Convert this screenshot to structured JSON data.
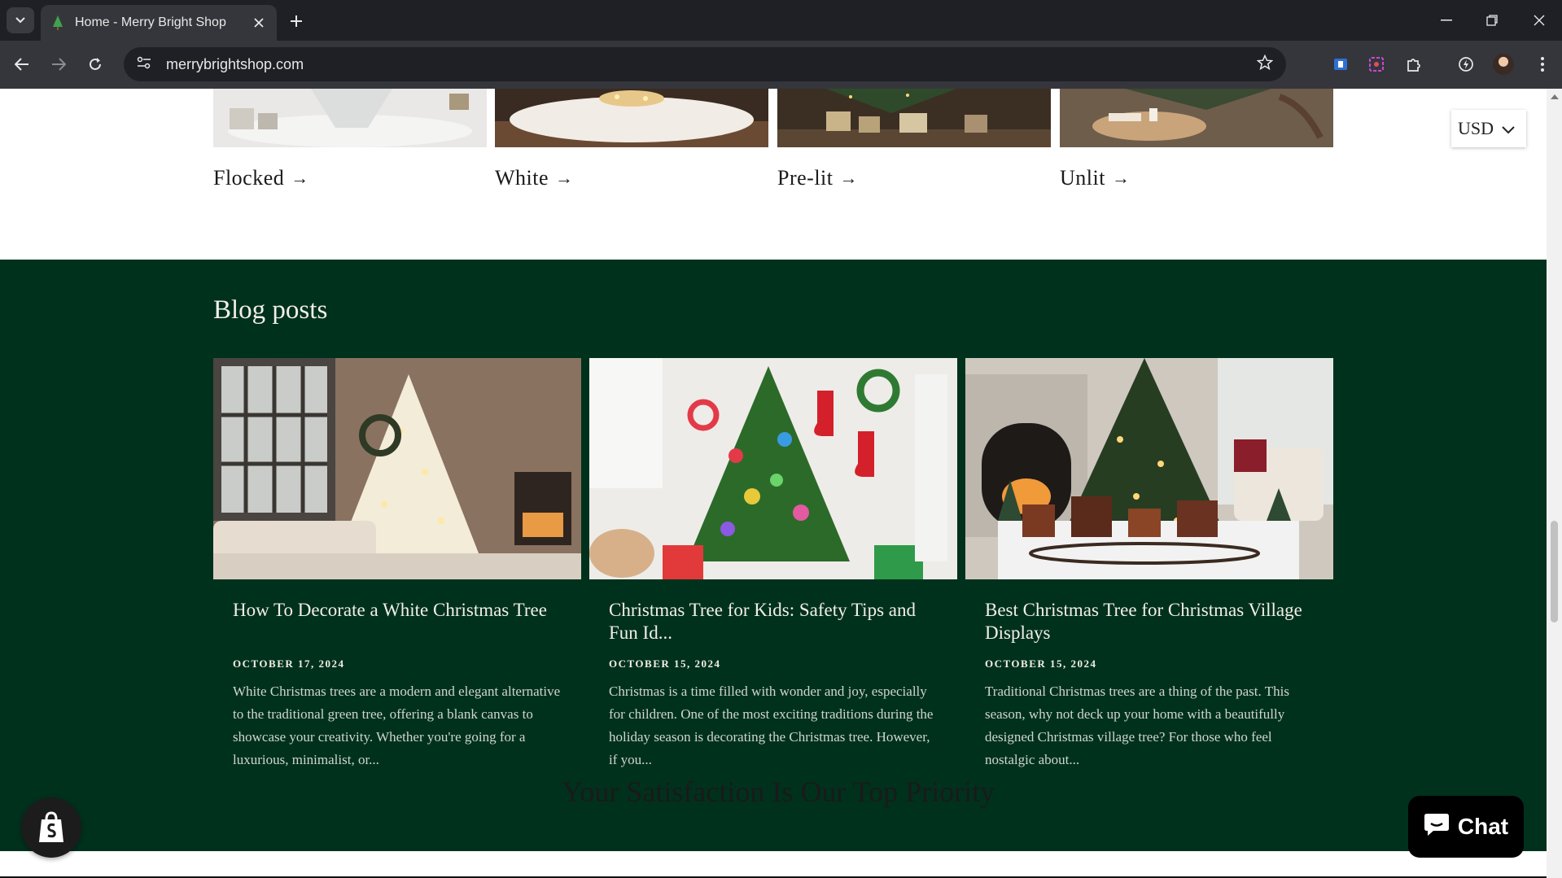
{
  "browser": {
    "tab_title": "Home - Merry Bright Shop",
    "url": "merrybrightshop.com",
    "icons": [
      "tab-search-icon",
      "tree-favicon-icon",
      "close-icon",
      "plus-icon",
      "minimize-icon",
      "restore-icon",
      "window-close-icon",
      "back-icon",
      "forward-icon",
      "reload-icon",
      "site-settings-icon",
      "star-icon",
      "extension-icon",
      "puzzle-icon",
      "avatar",
      "menu-icon"
    ]
  },
  "categories": [
    {
      "label": "Flocked"
    },
    {
      "label": "White"
    },
    {
      "label": "Pre-lit"
    },
    {
      "label": "Unlit"
    }
  ],
  "arrow_glyph": "→",
  "currency": {
    "selected": "USD"
  },
  "blog": {
    "heading": "Blog posts",
    "posts": [
      {
        "title": "How To Decorate a White Christmas Tree",
        "date": "OCTOBER 17, 2024",
        "excerpt": "White Christmas trees are a modern and elegant alternative to the traditional green tree, offering a blank canvas to showcase your creativity. Whether you're going for a luxurious, minimalist, or..."
      },
      {
        "title": "Christmas Tree for Kids: Safety Tips and Fun Id...",
        "date": "OCTOBER 15, 2024",
        "excerpt": "Christmas is a time filled with wonder and joy, especially for children. One of the most exciting traditions during the holiday season is decorating the Christmas tree. However, if you..."
      },
      {
        "title": "Best Christmas Tree for Christmas Village Displays",
        "date": "OCTOBER 15, 2024",
        "excerpt": "Traditional Christmas trees are a thing of the past. This season, why not deck up your home with a beautifully designed Christmas village tree? For those who feel nostalgic about..."
      }
    ]
  },
  "satisfaction_heading": "Your Satisfaction Is Our Top Priority",
  "chat": {
    "label": "Chat"
  },
  "colors": {
    "blog_bg": "#00311d",
    "browser_dark": "#1f2025",
    "browser_toolbar": "#35363b"
  }
}
